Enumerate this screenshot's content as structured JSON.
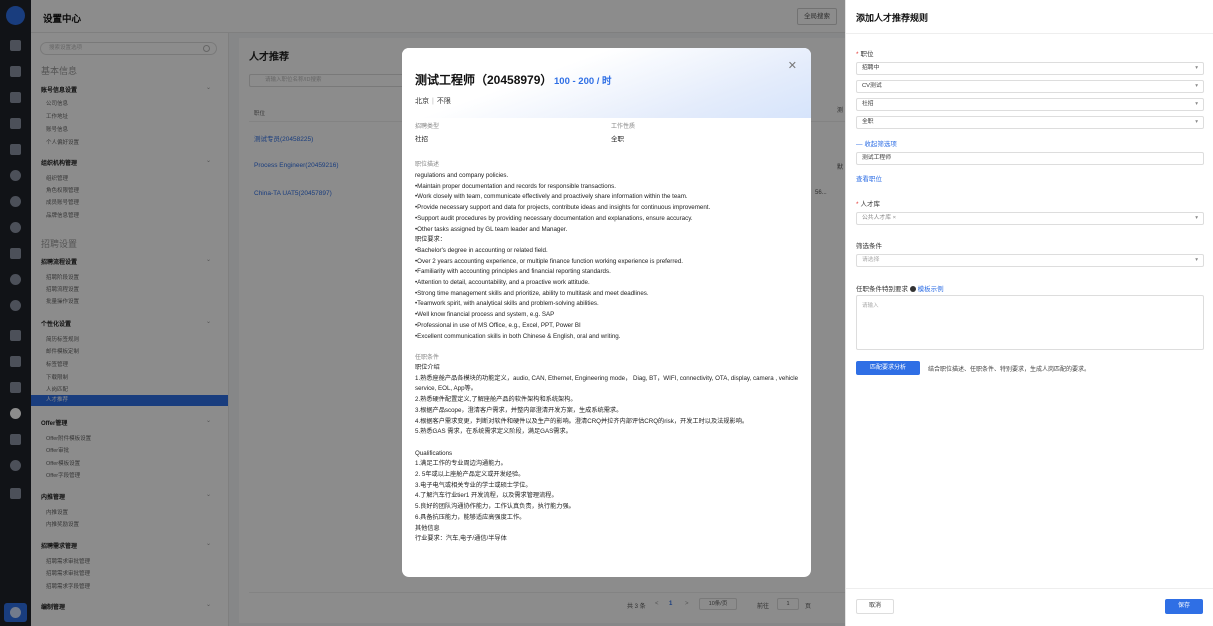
{
  "topbar": {
    "title": "设置中心",
    "global_search": "全局搜索"
  },
  "sidebar": {
    "search_placeholder": "搜索设置选项",
    "group_basic": "基本信息",
    "account": {
      "header": "账号信息设置",
      "items": [
        "公司信息",
        "工作地址",
        "账号信息",
        "个人偏好设置"
      ]
    },
    "org": {
      "header": "组织机构管理",
      "items": [
        "组织管理",
        "角色权限管理",
        "成员账号管理",
        "品牌信息管理"
      ]
    },
    "group_recruit": "招聘设置",
    "process": {
      "header": "招聘流程设置",
      "items": [
        "招聘阶段设置",
        "招聘流程设置",
        "批量操作设置"
      ]
    },
    "personal": {
      "header": "个性化设置",
      "items": [
        "简历标签规则",
        "邮件模板定制",
        "标签管理",
        "下载限制",
        "人岗匹配",
        "人才推荐"
      ]
    },
    "offer": {
      "header": "Offer管理",
      "items": [
        "Offer附件模板设置",
        "Offer审批",
        "Offer模板设置",
        "Offer字段管理"
      ]
    },
    "referral": {
      "header": "内推管理",
      "items": [
        "内推设置",
        "内推奖励设置"
      ]
    },
    "demand": {
      "header": "招聘需求管理",
      "items": [
        "招聘需求审批管理",
        "招聘需求审批管理",
        "招聘需求字段管理"
      ]
    },
    "edit": {
      "header": "编制管理"
    }
  },
  "main": {
    "title": "人才推荐",
    "search_placeholder": "请输入职位名称/ID搜索",
    "col_header": "职位",
    "rows": [
      "测试专员(20458225)",
      "Process Engineer(20459216)",
      "China-TA UAT5(20457897)"
    ],
    "partial_cells": [
      "测",
      "默",
      "56..."
    ],
    "pager": {
      "total": "共 3 条",
      "prev": "<",
      "page": "1",
      "next": ">",
      "page_size": "10条/页",
      "goto_label": "前往",
      "goto_value": "1",
      "page_unit": "页"
    }
  },
  "drawer": {
    "title": "添加人才推荐规则",
    "position_label": "职位",
    "filters": [
      "招聘中",
      "CV测试",
      "社招",
      "全职"
    ],
    "collapse_link": "收起筛选项",
    "position_value": "测试工程师",
    "view_link": "查看职位",
    "pool_label": "人才库",
    "pool_value": "公共人才库",
    "pool_tag": "×",
    "filter_label": "筛选条件",
    "filter_placeholder": "请选择",
    "req_label": "任职条件特别要求",
    "req_link": "模板示例",
    "req_placeholder": "请输入",
    "analyze_btn": "匹配要求分析",
    "analyze_text": "结合职位描述、任职条件、特别要求，生成人岗匹配的要求。",
    "cancel": "取消",
    "save": "保存"
  },
  "modal": {
    "title": "测试工程师（20458979）",
    "salary": "100 - 200 / 时",
    "city": "北京",
    "experience": "不限",
    "type_label": "招聘类型",
    "type_value": "社招",
    "nature_label": "工作性质",
    "nature_value": "全职",
    "desc_label": "职位描述",
    "desc_lines": [
      "regulations and company policies.",
      "•Maintain proper documentation and records for responsible transactions.",
      "•Work closely with team, communicate effectively and proactively share information within the team.",
      "•Provide necessary support and data for projects, contribute ideas and insights for continuous improvement.",
      "•Support audit procedures by providing necessary documentation and explanations, ensure accuracy.",
      "•Other tasks assigned by GL team leader and Manager.",
      "职位要求：",
      "•Bachelor's degree in accounting or related field.",
      "•Over 2 years accounting experience, or multiple finance function working experience is preferred.",
      "•Familiarity with accounting principles and financial reporting standards.",
      "•Attention to detail, accountability, and a proactive work attitude.",
      "•Strong time management skills and prioritize, ability to multitask and meet deadlines.",
      "•Teamwork spirit, with analytical skills and problem-solving abilities.",
      "•Well know financial process and system, e.g. SAP",
      "•Professional in use of MS Office, e.g., Excel, PPT, Power BI",
      "•Excellent communication skills in both Chinese & English, oral and writing."
    ],
    "req_label": "任职条件",
    "req_lines": [
      "职位介绍",
      "1.熟悉座舱产品各模块的功能定义，audio, CAN, Ethernet, Engineering mode， Diag, BT，WIFI, connectivity, OTA, display, camera , vehicle service, EOL, App等。",
      "2.熟悉硬件配置定义,了解座舱产品的软件架构和系统架构。",
      "3.根据产品scope，澄清客户需求，并整内部澄清开发方案，生成系统需求。",
      "4.根据客户需求变更，判断对软件和硬件以及生产的影响。澄清CRQ并拉齐内部评估CRQ的risk，开发工时以及法规影响。",
      "5.熟悉GAS 需求，在系统需求定义阶段，满足GAS需求。",
      "",
      "Qualifications",
      "1.满足工作的专业周边沟通能力。",
      "2. 5年或以上座舱产品定义或开发经验。",
      "3.电子电气或相关专业的学士或硕士学位。",
      "4.了解汽车行业tier1 开发流程，以及需求管理流程。",
      "5.良好的团队沟通协作能力，工作认真负责，执行能力强。",
      "6.具备抗压能力，能够适应高强度工作。",
      "其他信息",
      "行业要求：汽车,电子/通信/半导体"
    ]
  }
}
